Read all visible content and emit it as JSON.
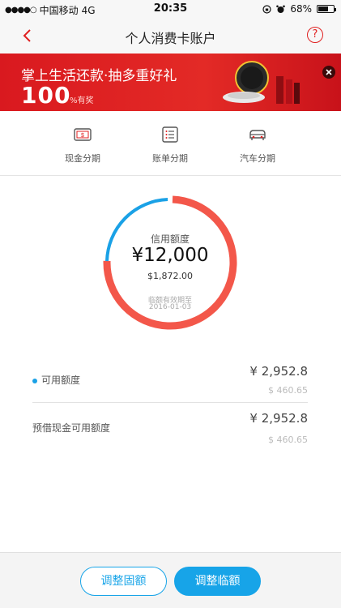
{
  "status_bar": {
    "carrier": "中国移动",
    "network": "4G",
    "time": "20:35",
    "battery": "68%",
    "battery_level": 0.68
  },
  "nav": {
    "title": "个人消费卡账户",
    "help_symbol": "?"
  },
  "banner": {
    "headline": "掌上生活还款·抽多重好礼",
    "big_number": "100",
    "suffix": "%有奖"
  },
  "shortcuts": [
    {
      "label": "现金分期",
      "icon": "cash-card-icon"
    },
    {
      "label": "账单分期",
      "icon": "bill-list-icon"
    },
    {
      "label": "汽车分期",
      "icon": "car-icon"
    }
  ],
  "credit": {
    "title": "信用额度",
    "amount": "¥12,000",
    "usd_amount": "$1,872.00",
    "temp_expiry_label": "临额有效期至",
    "temp_expiry_date": "2016-01-03",
    "available_fraction": 0.246
  },
  "rows": [
    {
      "label": "可用额度",
      "amount": "¥ 2,952.8",
      "usd": "$ 460.65"
    },
    {
      "label": "预借现金可用额度",
      "amount": "¥ 2,952.8",
      "usd": "$ 460.65"
    }
  ],
  "buttons": {
    "adjust_fixed": "调整固额",
    "adjust_temp": "调整临额"
  },
  "colors": {
    "accent_red": "#e02020",
    "ring_used": "#f3574a",
    "ring_available": "#1aa1e6",
    "button_blue": "#17a4e8"
  }
}
